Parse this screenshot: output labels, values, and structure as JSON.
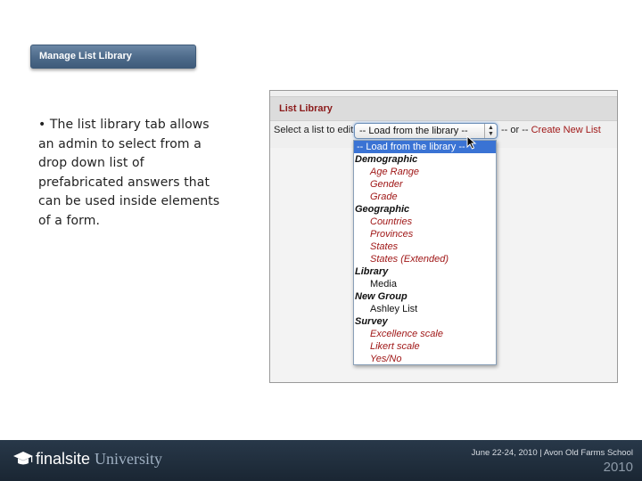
{
  "tab_button": {
    "label": "Manage List Library"
  },
  "bullet": {
    "text": "• The list library tab allows an admin to select from a drop down list of prefabricated answers that can be used inside elements of a form."
  },
  "panel": {
    "title": "List Library",
    "select_label": "Select a list to edit",
    "select_value": "-- Load from the library --",
    "or_text": "-- or --",
    "create_link": "Create New List",
    "title_color": "#8b1a1a",
    "link_color": "#a01818"
  },
  "dropdown": {
    "selected": "-- Load from the library --",
    "groups": [
      {
        "name": "Demographic",
        "options": [
          {
            "label": "Age Range",
            "style": "link"
          },
          {
            "label": "Gender",
            "style": "link"
          },
          {
            "label": "Grade",
            "style": "link"
          }
        ]
      },
      {
        "name": "Geographic",
        "options": [
          {
            "label": "Countries",
            "style": "link"
          },
          {
            "label": "Provinces",
            "style": "link"
          },
          {
            "label": "States",
            "style": "link"
          },
          {
            "label": "States (Extended)",
            "style": "link"
          }
        ]
      },
      {
        "name": "Library",
        "options": [
          {
            "label": "Media",
            "style": "plain"
          }
        ]
      },
      {
        "name": "New Group",
        "options": [
          {
            "label": "Ashley List",
            "style": "plain"
          }
        ]
      },
      {
        "name": "Survey",
        "options": [
          {
            "label": "Excellence scale",
            "style": "link"
          },
          {
            "label": "Likert scale",
            "style": "link"
          },
          {
            "label": "Yes/No",
            "style": "link"
          }
        ]
      }
    ],
    "highlight_color": "#3a73d4"
  },
  "footer": {
    "brand": "finalsite",
    "brand_suffix": "University",
    "event": "June 22-24, 2010 | Avon Old Farms School",
    "year": "2010",
    "icon": "graduation-cap-icon"
  }
}
